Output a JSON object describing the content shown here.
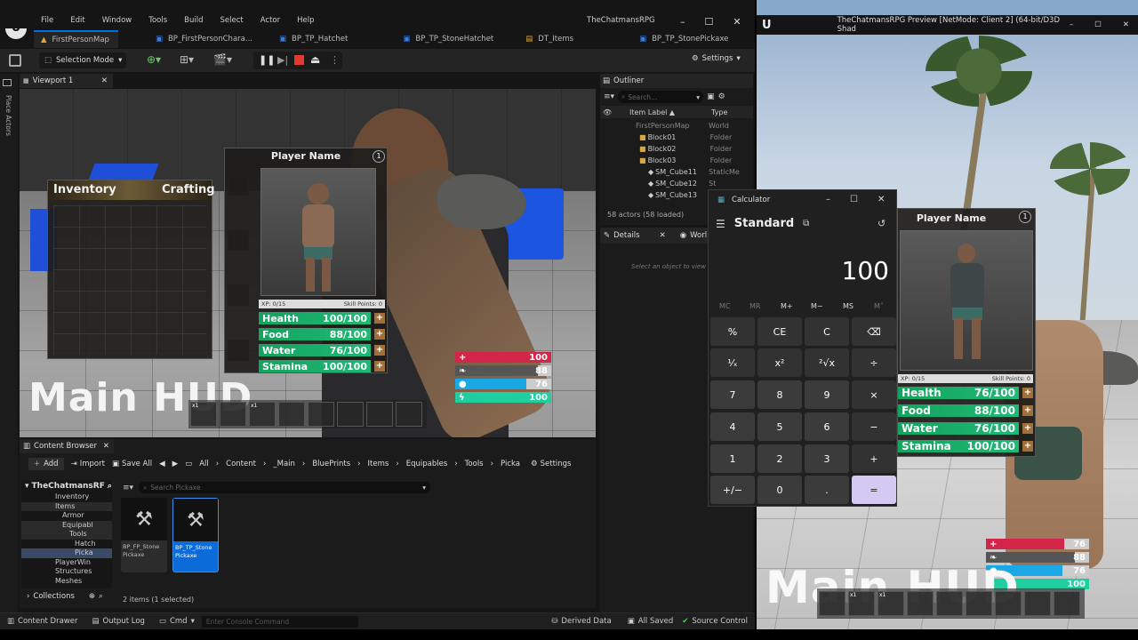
{
  "editor": {
    "menu": [
      "File",
      "Edit",
      "Window",
      "Tools",
      "Build",
      "Select",
      "Actor",
      "Help"
    ],
    "project_title": "TheChatmansRPG",
    "tabs": [
      "FirstPersonMap",
      "BP_FirstPersonChara...",
      "BP_TP_Hatchet",
      "BP_TP_StoneHatchet",
      "DT_Items",
      "BP_TP_StonePickaxe"
    ],
    "toolbar": {
      "mode": "Selection Mode",
      "settings": "Settings"
    },
    "side_label": "Place Actors",
    "viewport": {
      "tab": "Viewport 1",
      "inventory_title": "Inventory",
      "crafting_title": "Crafting",
      "player_name": "Player Name",
      "level": "1",
      "xp": "XP: 0/15",
      "skill_points": "Skill Points: 0",
      "stats": [
        {
          "name": "Health",
          "value": "100/100"
        },
        {
          "name": "Food",
          "value": "88/100"
        },
        {
          "name": "Water",
          "value": "76/100"
        },
        {
          "name": "Stamina",
          "value": "100/100"
        }
      ],
      "main_hud": "Main HUD",
      "hud_bars": [
        {
          "value": "100",
          "color": "#d3244a",
          "icon": "+"
        },
        {
          "value": "88",
          "color": "#6a6a6a",
          "icon": "❧"
        },
        {
          "value": "76",
          "color": "#1aa7e6",
          "icon": "●"
        },
        {
          "value": "100",
          "color": "#1fcfa0",
          "icon": "ϟ"
        }
      ],
      "hotbar": [
        "x1",
        "",
        "x1",
        "",
        "",
        "",
        "",
        "",
        "",
        ""
      ]
    },
    "outliner": {
      "tab": "Outliner",
      "search_placeholder": "Search...",
      "col_label": "Item Label ▲",
      "col_type": "Type",
      "rows": [
        {
          "label": "FirstPersonMap",
          "type": "World"
        },
        {
          "label": "Block01",
          "type": "Folder"
        },
        {
          "label": "Block02",
          "type": "Folder"
        },
        {
          "label": "Block03",
          "type": "Folder"
        },
        {
          "label": "SM_Cube11",
          "type": "StaticMe"
        },
        {
          "label": "SM_Cube12",
          "type": "St"
        },
        {
          "label": "SM_Cube13",
          "type": ""
        }
      ],
      "footer": "58 actors (58 loaded)"
    },
    "details": {
      "tab": "Details",
      "tab2": "Worl",
      "hint": "Select an object to view"
    },
    "content_browser": {
      "tab": "Content Browser",
      "add": "Add",
      "import": "Import",
      "save_all": "Save All",
      "breadcrumb": [
        "All",
        "Content",
        "_Main",
        "BluePrints",
        "Items",
        "Equipables",
        "Tools",
        "Picka"
      ],
      "settings": "Settings",
      "root": "TheChatmansRF",
      "tree": [
        "Inventory",
        "Items",
        "Armor",
        "Equipabl",
        "Tools",
        "Hatch",
        "Picka",
        "PlayerWin",
        "Structures",
        "Meshes"
      ],
      "search_placeholder": "Search Pickaxe",
      "assets": [
        {
          "name": "BP_FP_Stone Pickaxe"
        },
        {
          "name": "BP_TP_Stone Pickaxe"
        }
      ],
      "collections": "Collections",
      "count": "2 items (1 selected)"
    },
    "statusbar": {
      "drawer": "Content Drawer",
      "output": "Output Log",
      "cmd": "Cmd",
      "console_placeholder": "Enter Console Command",
      "derived": "Derived Data",
      "saved": "All Saved",
      "source": "Source Control"
    }
  },
  "calculator": {
    "title": "Calculator",
    "mode": "Standard",
    "display": "100",
    "memory": [
      "MC",
      "MR",
      "M+",
      "M−",
      "MS",
      "M˅"
    ],
    "keys": [
      [
        "%",
        "CE",
        "C",
        "⌫"
      ],
      [
        "¹⁄ₓ",
        "x²",
        "²√x",
        "÷"
      ],
      [
        "7",
        "8",
        "9",
        "×"
      ],
      [
        "4",
        "5",
        "6",
        "−"
      ],
      [
        "1",
        "2",
        "3",
        "+"
      ],
      [
        "+/−",
        "0",
        ".",
        "="
      ]
    ]
  },
  "preview": {
    "title": "TheChatmansRPG Preview [NetMode: Client 2]  (64-bit/D3D Shad",
    "player_name": "Player Name",
    "level": "1",
    "xp": "XP: 0/15",
    "skill_points": "Skill Points: 0",
    "stats": [
      {
        "name": "Health",
        "value": "76/100"
      },
      {
        "name": "Food",
        "value": "88/100"
      },
      {
        "name": "Water",
        "value": "76/100"
      },
      {
        "name": "Stamina",
        "value": "100/100"
      }
    ],
    "main_hud": "Main HUD",
    "hud_bars": [
      {
        "value": "76",
        "color": "#d3244a",
        "icon": "+"
      },
      {
        "value": "88",
        "color": "#6a6a6a",
        "icon": "❧"
      },
      {
        "value": "76",
        "color": "#1aa7e6",
        "icon": "●"
      },
      {
        "value": "100",
        "color": "#1fcfa0",
        "icon": "ϟ"
      }
    ],
    "hotbar": [
      "x1",
      "x1",
      "",
      "",
      "",
      "",
      "",
      "",
      ""
    ]
  }
}
